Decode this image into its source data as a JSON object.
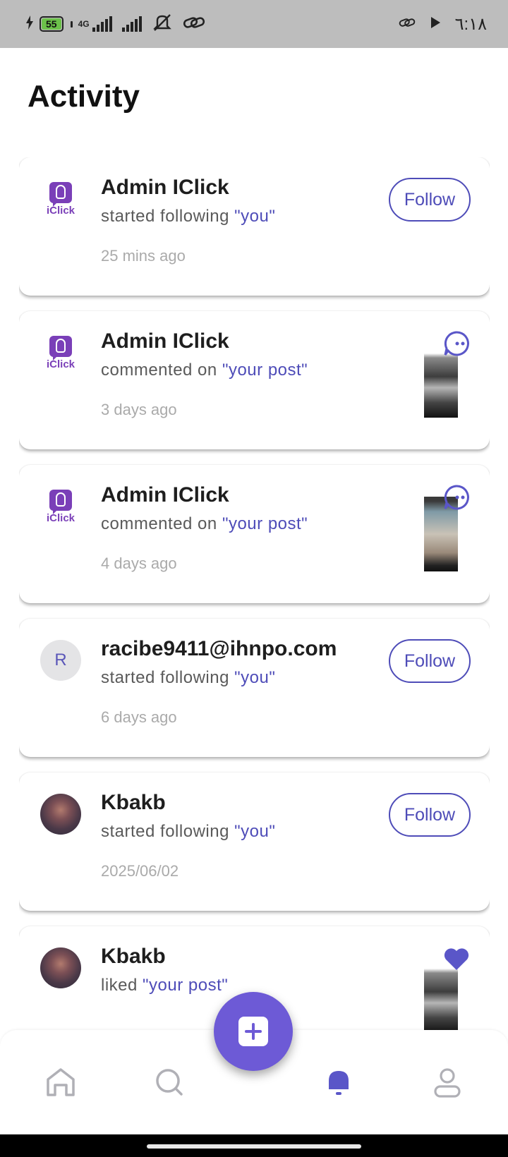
{
  "status_bar": {
    "battery": "55",
    "network": "4G",
    "time": "٦:١٨"
  },
  "page": {
    "title": "Activity"
  },
  "activity": [
    {
      "avatar": "iClick",
      "name": "Admin IClick",
      "action": "started following",
      "target": "\"you\"",
      "time": "25 mins ago",
      "right": "follow"
    },
    {
      "avatar": "iClick",
      "name": "Admin IClick",
      "action": "commented on",
      "target": "\"your post\"",
      "time": "3 days ago",
      "right": "post",
      "badge": "comment-icon"
    },
    {
      "avatar": "iClick",
      "name": "Admin IClick",
      "action": "commented on",
      "target": "\"your post\"",
      "time": "4 days ago",
      "right": "post",
      "badge": "comment-icon"
    },
    {
      "avatar": "R",
      "name": "racibe9411@ihnpo.com",
      "action": "started following",
      "target": "\"you\"",
      "time": "6 days ago",
      "right": "follow"
    },
    {
      "avatar": "photo",
      "name": "Kbakb",
      "action": "started following",
      "target": "\"you\"",
      "time": "2025/06/02",
      "right": "follow"
    },
    {
      "avatar": "photo",
      "name": "Kbakb",
      "action": "liked",
      "target": "\"your post\"",
      "time": "",
      "right": "post",
      "badge": "heart-icon"
    }
  ],
  "follow_label": "Follow",
  "nav": {
    "items": [
      "home-icon",
      "search-icon",
      "add-icon",
      "bell-icon",
      "profile-icon"
    ],
    "active": "bell-icon"
  },
  "colors": {
    "accent": "#4e4cb8",
    "fab": "#6d5ad6",
    "brand": "#7a3fb8"
  }
}
